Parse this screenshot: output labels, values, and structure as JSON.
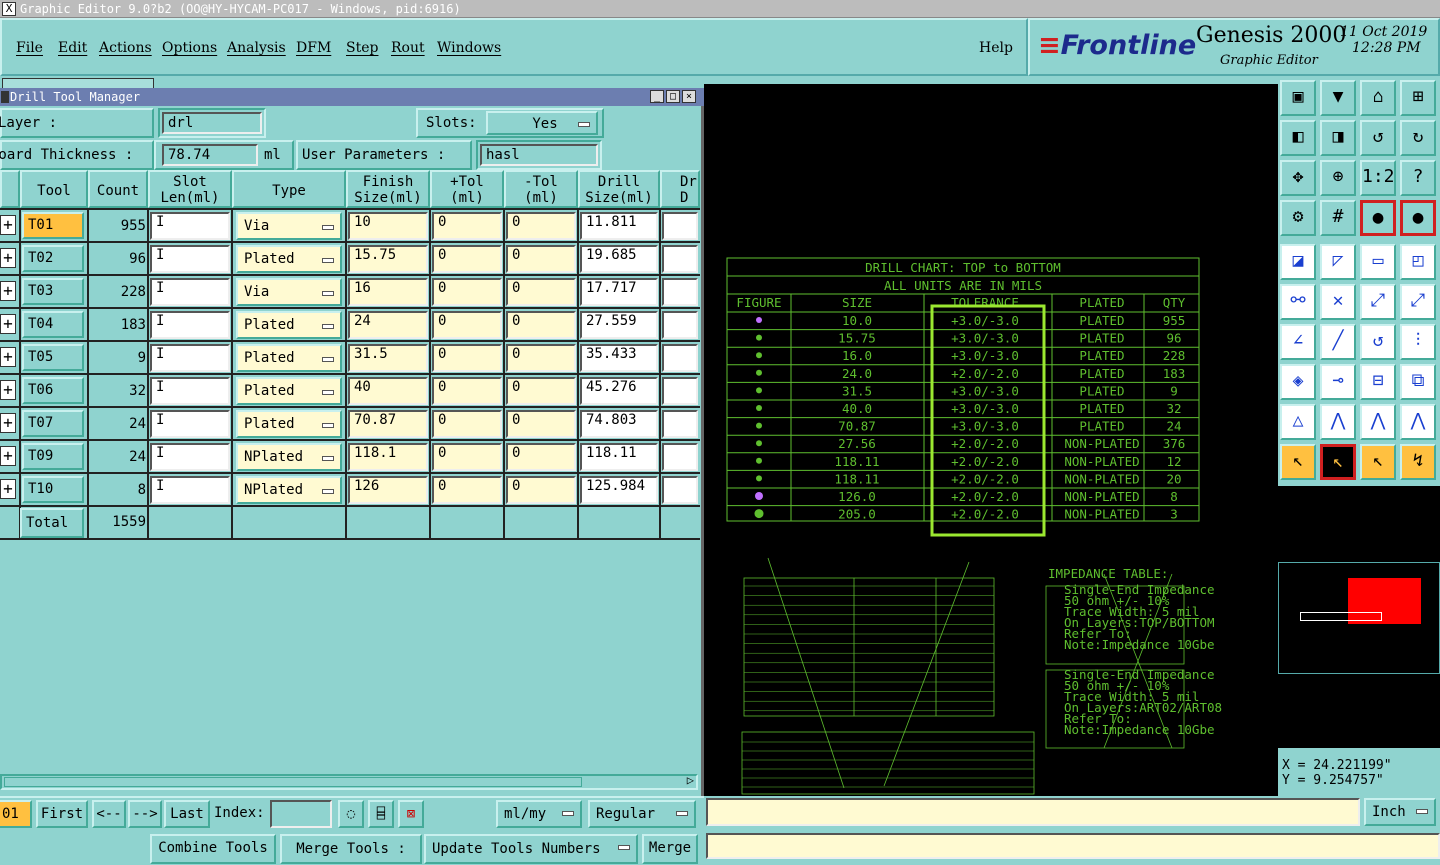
{
  "window": {
    "title": "Graphic Editor 9.0?b2 (OO@HY-HYCAM-PC017 - Windows, pid:6916)"
  },
  "menu": {
    "file": "File",
    "edit": "Edit",
    "actions": "Actions",
    "options": "Options",
    "analysis": "Analysis",
    "dfm": "DFM",
    "step": "Step",
    "rout": "Rout",
    "windows": "Windows",
    "help": "Help"
  },
  "brand": {
    "logo": "Frontline",
    "product": "Genesis 2000",
    "subtitle": "Graphic Editor",
    "date": "11 Oct 2019",
    "time": "12:28 PM"
  },
  "dialog": {
    "title": "Drill Tool Manager",
    "layer_label": "Layer        :",
    "layer_value": "drl",
    "slots_label": "Slots:",
    "slots_value": "Yes",
    "board_thickness_label": "Board Thickness :",
    "board_thickness_value": "78.74",
    "board_thickness_unit": "ml",
    "user_params_label": "User Parameters :",
    "user_params_value": "hasl",
    "columns": {
      "tool": "Tool",
      "count": "Count",
      "slot1": "Slot",
      "slot2": "Len(ml)",
      "type": "Type",
      "finish1": "Finish",
      "finish2": "Size(ml)",
      "ptol1": "+Tol",
      "ptol2": "(ml)",
      "ntol1": "-Tol",
      "ntol2": "(ml)",
      "drill1": "Drill",
      "drill2": "Size(ml)",
      "extra1": "Dr",
      "extra2": "D"
    },
    "rows": [
      {
        "tool": "T01",
        "count": "955",
        "type": "Via",
        "finish": "10",
        "ptol": "0",
        "ntol": "0",
        "drill": "11.811"
      },
      {
        "tool": "T02",
        "count": "96",
        "type": "Plated",
        "finish": "15.75",
        "ptol": "0",
        "ntol": "0",
        "drill": "19.685"
      },
      {
        "tool": "T03",
        "count": "228",
        "type": "Via",
        "finish": "16",
        "ptol": "0",
        "ntol": "0",
        "drill": "17.717"
      },
      {
        "tool": "T04",
        "count": "183",
        "type": "Plated",
        "finish": "24",
        "ptol": "0",
        "ntol": "0",
        "drill": "27.559"
      },
      {
        "tool": "T05",
        "count": "9",
        "type": "Plated",
        "finish": "31.5",
        "ptol": "0",
        "ntol": "0",
        "drill": "35.433"
      },
      {
        "tool": "T06",
        "count": "32",
        "type": "Plated",
        "finish": "40",
        "ptol": "0",
        "ntol": "0",
        "drill": "45.276"
      },
      {
        "tool": "T07",
        "count": "24",
        "type": "Plated",
        "finish": "70.87",
        "ptol": "0",
        "ntol": "0",
        "drill": "74.803"
      },
      {
        "tool": "T09",
        "count": "24",
        "type": "NPlated",
        "finish": "118.1",
        "ptol": "0",
        "ntol": "0",
        "drill": "118.11"
      },
      {
        "tool": "T10",
        "count": "8",
        "type": "NPlated",
        "finish": "126",
        "ptol": "0",
        "ntol": "0",
        "drill": "125.984"
      }
    ],
    "total_label": "Total",
    "total_value": "1559",
    "nav": {
      "current": "01",
      "first": "First",
      "prev": "<--",
      "next": "-->",
      "last": "Last",
      "index_label": "Index:",
      "units": "ml/my",
      "mode": "Regular"
    },
    "actions": {
      "combine": "Combine Tools",
      "merge_label": "Merge Tools :",
      "update": "Update Tools Numbers",
      "merge": "Merge"
    }
  },
  "drill_chart": {
    "title": "DRILL CHART: TOP to BOTTOM",
    "subtitle": "ALL UNITS ARE IN MILS",
    "headers": [
      "FIGURE",
      "SIZE",
      "TOLERANCE",
      "PLATED",
      "QTY"
    ],
    "rows": [
      {
        "size": "10.0",
        "tol": "+3.0/-3.0",
        "plated": "PLATED",
        "qty": "955",
        "fig": "#c070ff"
      },
      {
        "size": "15.75",
        "tol": "+3.0/-3.0",
        "plated": "PLATED",
        "qty": "96",
        "fig": "#5fbf2f"
      },
      {
        "size": "16.0",
        "tol": "+3.0/-3.0",
        "plated": "PLATED",
        "qty": "228",
        "fig": "#5fbf2f"
      },
      {
        "size": "24.0",
        "tol": "+2.0/-2.0",
        "plated": "PLATED",
        "qty": "183",
        "fig": "#5fbf2f"
      },
      {
        "size": "31.5",
        "tol": "+3.0/-3.0",
        "plated": "PLATED",
        "qty": "9",
        "fig": "#5fbf2f"
      },
      {
        "size": "40.0",
        "tol": "+3.0/-3.0",
        "plated": "PLATED",
        "qty": "32",
        "fig": "#5fbf2f"
      },
      {
        "size": "70.87",
        "tol": "+3.0/-3.0",
        "plated": "PLATED",
        "qty": "24",
        "fig": "#5fbf2f"
      },
      {
        "size": "27.56",
        "tol": "+2.0/-2.0",
        "plated": "NON-PLATED",
        "qty": "376",
        "fig": "#5fbf2f"
      },
      {
        "size": "118.11",
        "tol": "+2.0/-2.0",
        "plated": "NON-PLATED",
        "qty": "12",
        "fig": "#5fbf2f"
      },
      {
        "size": "118.11",
        "tol": "+2.0/-2.0",
        "plated": "NON-PLATED",
        "qty": "20",
        "fig": "#5fbf2f"
      },
      {
        "size": "126.0",
        "tol": "+2.0/-2.0",
        "plated": "NON-PLATED",
        "qty": "8",
        "fig": "#c070ff"
      },
      {
        "size": "205.0",
        "tol": "+2.0/-2.0",
        "plated": "NON-PLATED",
        "qty": "3",
        "fig": "#5fbf2f"
      }
    ]
  },
  "impedance": {
    "title": "IMPEDANCE TABLE:",
    "block1": [
      "Single-End Impedance",
      "50 ohm +/- 10%",
      "Trace Width: 5 mil",
      "On Layers:TOP/BOTTOM",
      "Refer To:",
      "Note:Impedance 10Gbe"
    ],
    "block2": [
      "Single-End Impedance",
      "50 ohm +/- 10%",
      "Trace Width: 5 mil",
      "On Layers:ART02/ART08",
      "Refer To:",
      "Note:Impedance 10Gbe"
    ]
  },
  "coords": {
    "x": "X = 24.221199\"",
    "y": "Y = 9.254757\""
  },
  "units_dropdown": "Inch",
  "colors": {
    "panel": "#8fd3cf",
    "canvas": "#000000",
    "chart_green": "#5fbf2f",
    "highlight_box": "#9be830",
    "selected_tool": "#ffc040"
  }
}
